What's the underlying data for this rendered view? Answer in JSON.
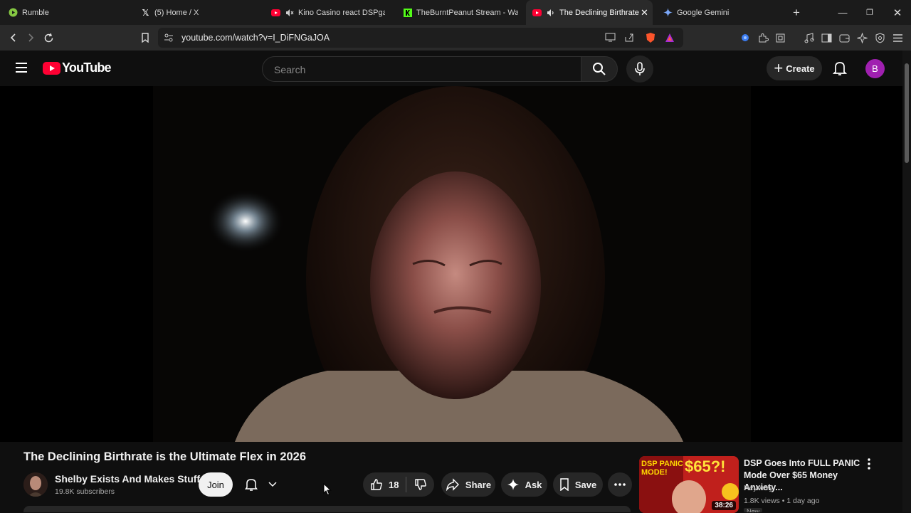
{
  "browser": {
    "tabs": [
      {
        "title": "Rumble",
        "icon": "rumble-icon"
      },
      {
        "title": "(5) Home / X",
        "icon": "x-icon"
      },
      {
        "title": "Kino Casino react DSPgamin",
        "icon": "youtube-icon"
      },
      {
        "title": "TheBurntPeanut Stream - Watch",
        "icon": "kick-icon"
      },
      {
        "title": "The Declining Birthrate is",
        "icon": "youtube-icon",
        "active": true
      },
      {
        "title": "Google Gemini",
        "icon": "gemini-icon"
      }
    ],
    "url": "youtube.com/watch?v=I_DiFNGaJOA"
  },
  "youtube": {
    "logo_text": "YouTube",
    "search_placeholder": "Search",
    "create_label": "Create",
    "avatar_letter": "B"
  },
  "video": {
    "title": "The Declining Birthrate is the Ultimate Flex in 2026",
    "channel": "Shelby Exists And Makes Stuff",
    "subscribers": "19.8K subscribers",
    "join_label": "Join",
    "likes": "18",
    "share_label": "Share",
    "ask_label": "Ask",
    "save_label": "Save"
  },
  "recommended": {
    "title": "DSP Goes Into FULL PANIC Mode Over $65 Money Anxiety...",
    "channel": "HeyArVy",
    "meta": "1.8K views • 1 day ago",
    "badge": "New",
    "duration": "38:26",
    "thumb_text_1": "DSP PANIC MODE!",
    "thumb_text_2": "$65?!"
  },
  "colors": {
    "youtube_red": "#ff0033",
    "background": "#0f0f0f",
    "avatar": "#a020b0"
  }
}
